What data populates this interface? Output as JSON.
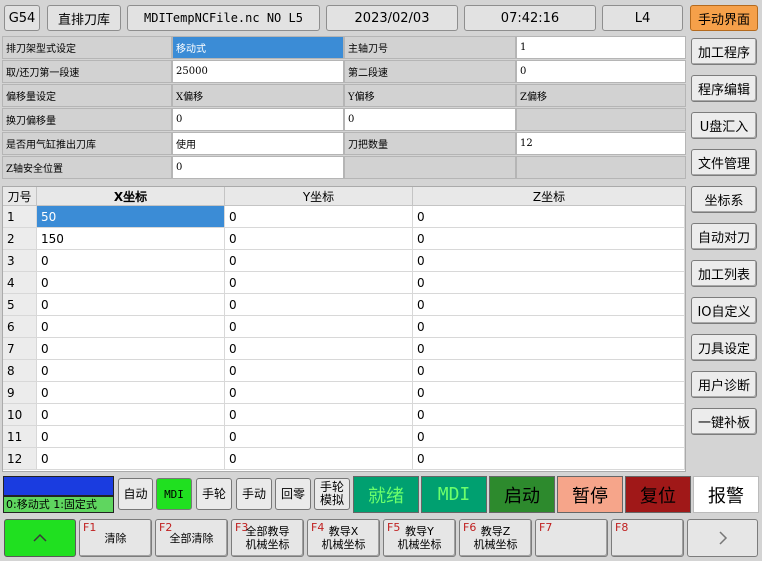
{
  "topbar": {
    "coord": "G54",
    "magazine": "直排刀库",
    "file": "MDITempNCFile.nc NO L5",
    "date": "2023/02/03",
    "time": "07:42:16",
    "level": "L4",
    "mode": "手动界面"
  },
  "side_menu": [
    "加工程序",
    "程序编辑",
    "U盘汇入",
    "文件管理",
    "坐标系",
    "自动对刀",
    "加工列表",
    "IO自定义",
    "刀具设定",
    "用户诊断",
    "一键补板"
  ],
  "params": {
    "r1": {
      "l1": "排刀架型式设定",
      "v1": "移动式",
      "l2": "主轴刀号",
      "v2": "1"
    },
    "r2": {
      "l1": "取/还刀第一段速",
      "v1": "25000",
      "l2": "第二段速",
      "v2": "0"
    },
    "r3": {
      "l1": "偏移量设定",
      "v1": "X偏移",
      "l2": " Y偏移",
      "v2": "Z偏移"
    },
    "r4": {
      "l1": "换刀偏移量",
      "v1": "0",
      "l2": "0",
      "v2": ""
    },
    "r5": {
      "l1": "是否用气缸推出刀库",
      "v1": "使用",
      "l2": "刀把数量",
      "v2": "12"
    },
    "r6": {
      "l1": "Z轴安全位置",
      "v1": "0",
      "l2": "",
      "v2": ""
    }
  },
  "table": {
    "headers": [
      "刀号",
      "X坐标",
      "Y坐标",
      "Z坐标"
    ],
    "rows": [
      [
        "1",
        "50",
        "0",
        "0"
      ],
      [
        "2",
        "150",
        "0",
        "0"
      ],
      [
        "3",
        "0",
        "0",
        "0"
      ],
      [
        "4",
        "0",
        "0",
        "0"
      ],
      [
        "5",
        "0",
        "0",
        "0"
      ],
      [
        "6",
        "0",
        "0",
        "0"
      ],
      [
        "7",
        "0",
        "0",
        "0"
      ],
      [
        "8",
        "0",
        "0",
        "0"
      ],
      [
        "9",
        "0",
        "0",
        "0"
      ],
      [
        "10",
        "0",
        "0",
        "0"
      ],
      [
        "11",
        "0",
        "0",
        "0"
      ],
      [
        "12",
        "0",
        "0",
        "0"
      ]
    ]
  },
  "status": {
    "hint": "0:移动式 1:固定式",
    "modes": [
      "自动",
      "MDI",
      "手轮",
      "手动",
      "回零",
      "手轮模拟"
    ],
    "state": "就绪",
    "mdi": "MDI",
    "start": "启动",
    "pause": "暂停",
    "reset": "复位",
    "alarm": "报警"
  },
  "fkeys": [
    {
      "n": "F1",
      "label": "清除"
    },
    {
      "n": "F2",
      "label": "全部清除"
    },
    {
      "n": "F3",
      "label": "全部教导\n机械坐标"
    },
    {
      "n": "F4",
      "label": "教导X\n机械坐标"
    },
    {
      "n": "F5",
      "label": "教导Y\n机械坐标"
    },
    {
      "n": "F6",
      "label": "教导Z\n机械坐标"
    },
    {
      "n": "F7",
      "label": ""
    },
    {
      "n": "F8",
      "label": ""
    }
  ],
  "colors": {
    "accent_orange": "#f5a04a",
    "selected_blue": "#3b8cd6",
    "state_green": "#00a070",
    "start_green": "#2d8a2d",
    "pause_salmon": "#f6a58a",
    "reset_red": "#a01818"
  },
  "icons": {
    "up": "chevron-up-icon",
    "next": "chevron-right-icon"
  }
}
